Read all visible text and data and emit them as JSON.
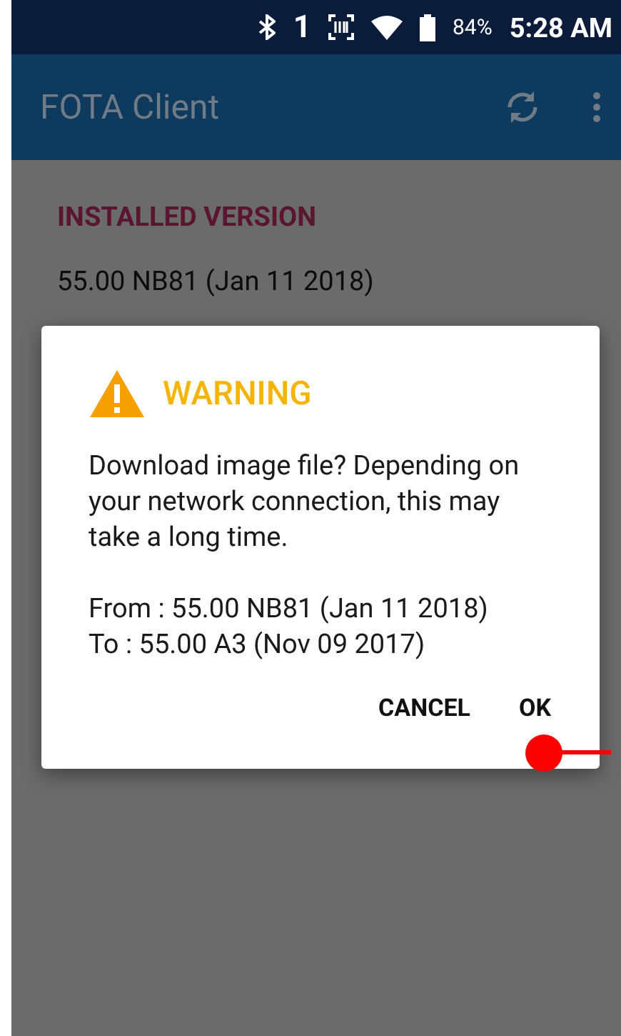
{
  "status_bar": {
    "sim": "1",
    "battery": "84%",
    "time": "5:28 AM"
  },
  "app_bar": {
    "title": "FOTA Client"
  },
  "content": {
    "section_title": "INSTALLED VERSION",
    "version": "55.00 NB81 (Jan 11 2018)"
  },
  "dialog": {
    "title": "WARNING",
    "message": "Download image file? Depending on your network connection, this may take a long time.",
    "from": "From : 55.00 NB81 (Jan 11 2018)",
    "to": "To : 55.00 A3 (Nov 09 2017)",
    "buttons": [
      "CANCEL",
      "OK"
    ]
  }
}
